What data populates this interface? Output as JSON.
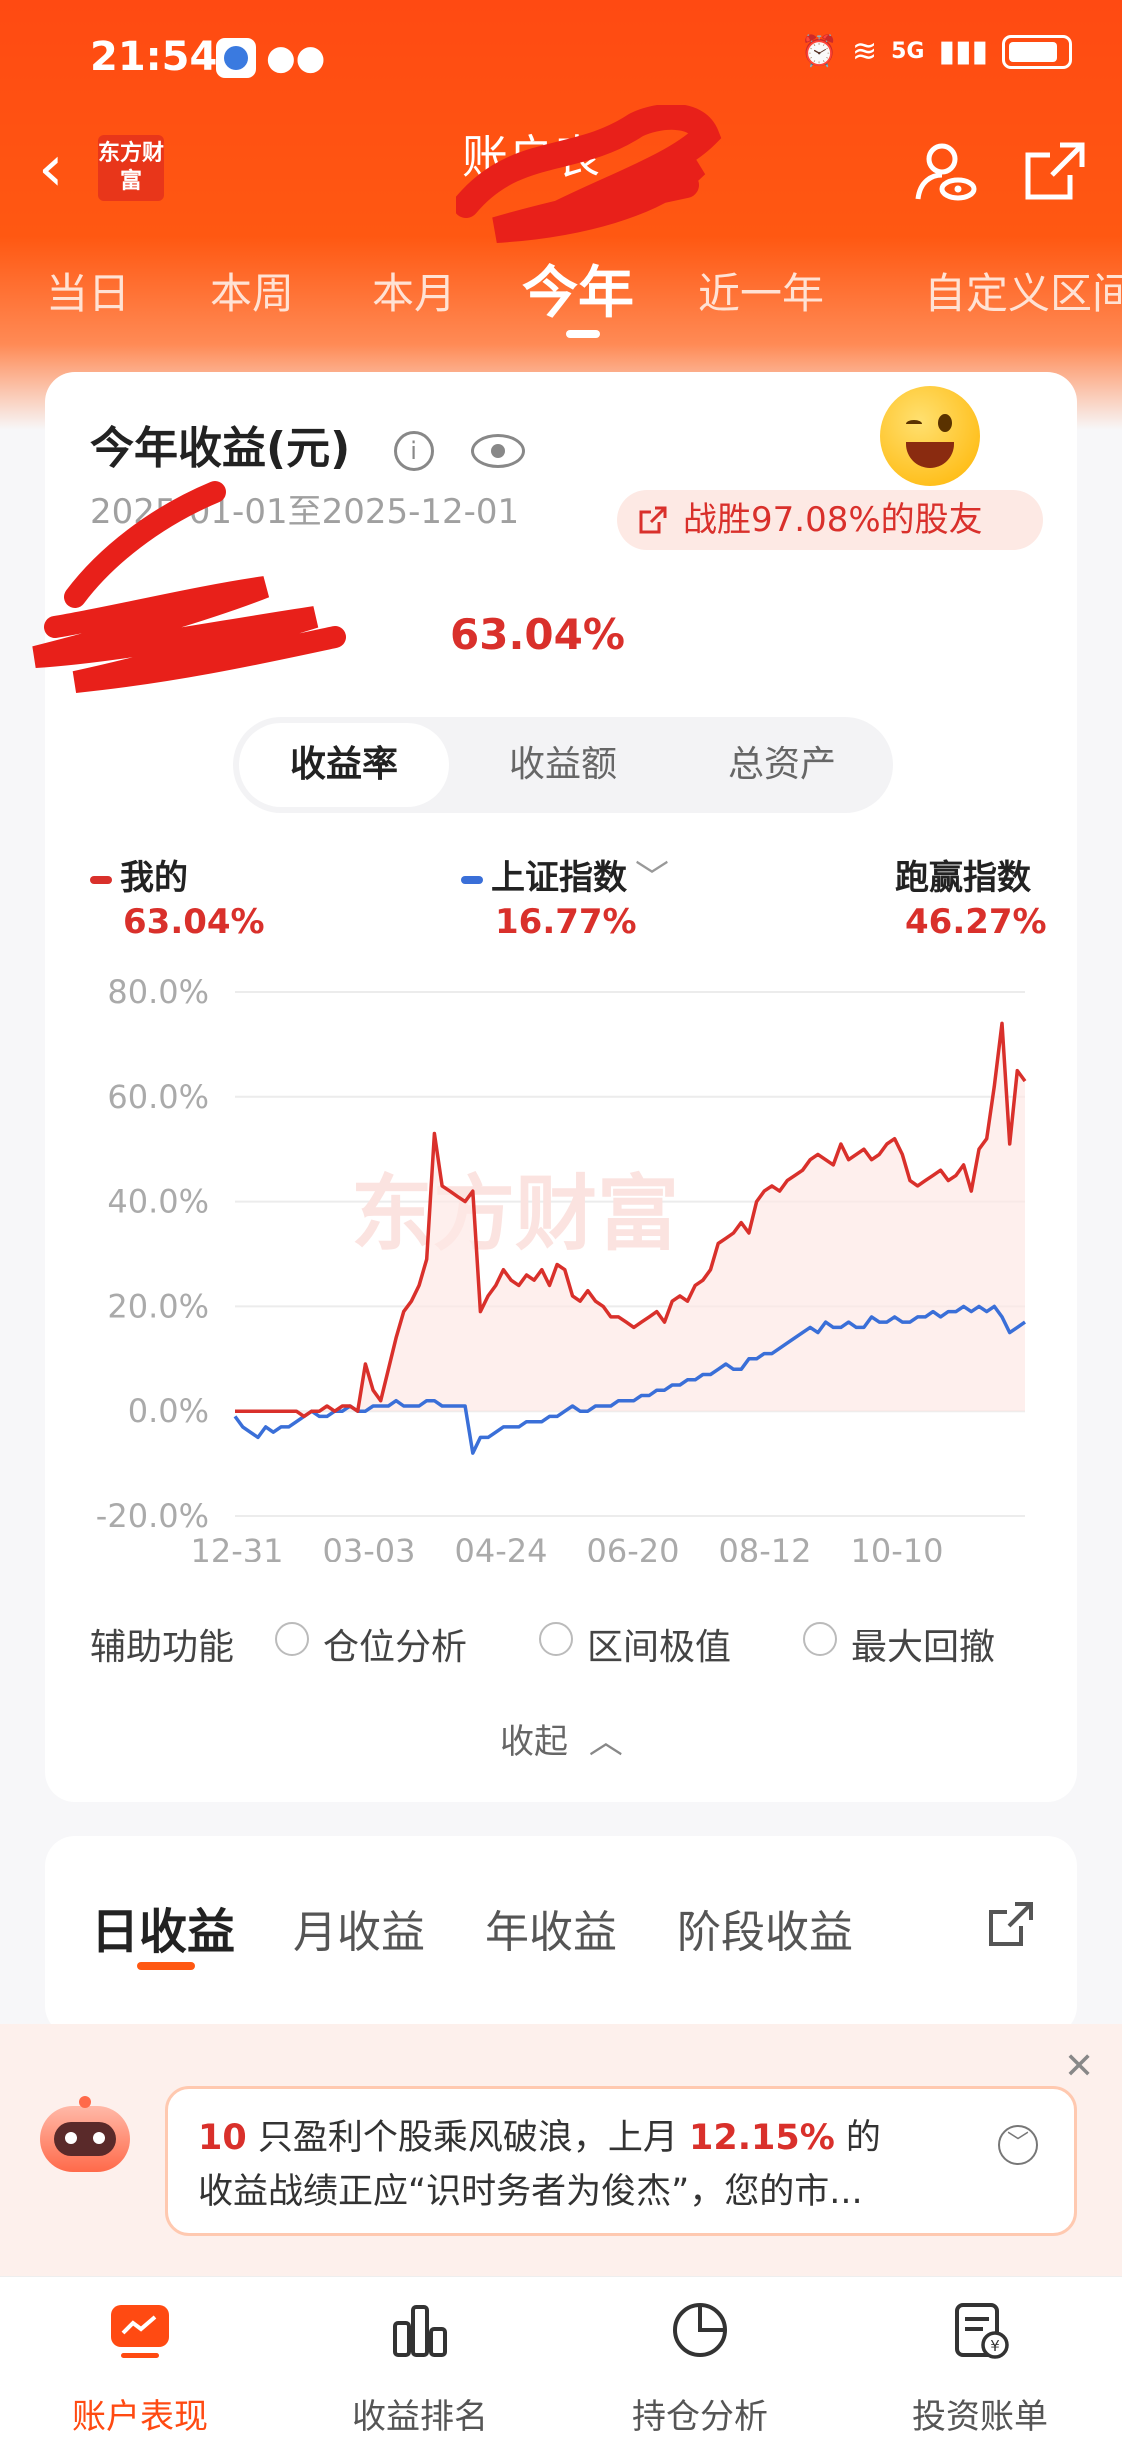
{
  "status": {
    "time": "21:54",
    "net": "5G"
  },
  "nav": {
    "title_visible": "账户表",
    "brand": "东方财富"
  },
  "periods": [
    "当日",
    "本周",
    "本月",
    "今年",
    "近一年",
    "自定义区间"
  ],
  "active_period": "今年",
  "card": {
    "title": "今年收益(元)",
    "date_range": "2025-01-01至2025-12-01",
    "win_badge": "战胜97.08%的股友",
    "return_pct": "63.04%",
    "segments": [
      "收益率",
      "收益额",
      "总资产"
    ],
    "active_segment": "收益率",
    "legend": [
      {
        "name": "我的",
        "value": "63.04%",
        "color": "#d9302b"
      },
      {
        "name": "上证指数",
        "value": "16.77%",
        "color": "#3a6fd8"
      },
      {
        "name": "跑赢指数",
        "value": "46.27%"
      }
    ],
    "aux_label": "辅助功能",
    "aux_options": [
      "仓位分析",
      "区间极值",
      "最大回撤"
    ],
    "collapse": "收起"
  },
  "chart_data": {
    "type": "line",
    "y_ticks": [
      "80.0%",
      "60.0%",
      "40.0%",
      "20.0%",
      "0.0%",
      "-20.0%"
    ],
    "x_ticks": [
      "12-31",
      "03-03",
      "04-24",
      "06-20",
      "08-12",
      "10-10"
    ],
    "ylim": [
      -20,
      80
    ],
    "watermark": "东方财富",
    "series": [
      {
        "name": "我的",
        "color": "#d9302b",
        "values": [
          0,
          0,
          0,
          0,
          0,
          0,
          0,
          0,
          0,
          -1,
          0,
          0,
          1,
          0,
          1,
          1,
          0,
          9,
          4,
          2,
          8,
          14,
          19,
          21,
          24,
          29,
          53,
          43,
          42,
          41,
          40,
          42,
          19,
          22,
          24,
          27,
          25,
          24,
          26,
          25,
          27,
          24,
          28,
          27,
          22,
          21,
          23,
          21,
          20,
          18,
          18,
          17,
          16,
          17,
          18,
          19,
          17,
          21,
          22,
          21,
          24,
          25,
          27,
          32,
          33,
          34,
          36,
          34,
          40,
          42,
          43,
          42,
          44,
          45,
          46,
          48,
          49,
          48,
          47,
          51,
          48,
          49,
          50,
          48,
          49,
          51,
          52,
          49,
          44,
          43,
          44,
          45,
          46,
          44,
          45,
          47,
          42,
          50,
          52,
          62,
          74,
          51,
          65,
          63
        ]
      },
      {
        "name": "上证指数",
        "color": "#3a6fd8",
        "values": [
          -1,
          -3,
          -4,
          -5,
          -3,
          -4,
          -3,
          -3,
          -2,
          -1,
          0,
          -1,
          -1,
          0,
          0,
          1,
          0,
          0,
          1,
          1,
          1,
          2,
          1,
          1,
          1,
          2,
          2,
          1,
          1,
          1,
          1,
          -8,
          -5,
          -5,
          -4,
          -3,
          -3,
          -3,
          -2,
          -2,
          -2,
          -1,
          -1,
          0,
          1,
          0,
          0,
          1,
          1,
          1,
          2,
          2,
          2,
          3,
          3,
          4,
          4,
          5,
          5,
          6,
          6,
          7,
          7,
          8,
          9,
          8,
          8,
          10,
          10,
          11,
          11,
          12,
          13,
          14,
          15,
          16,
          15,
          17,
          16,
          16,
          17,
          16,
          16,
          18,
          17,
          17,
          18,
          17,
          17,
          18,
          18,
          19,
          18,
          19,
          19,
          20,
          19,
          20,
          19,
          20,
          18,
          15,
          16,
          17
        ]
      }
    ]
  },
  "profit_tabs": [
    "日收益",
    "月收益",
    "年收益",
    "阶段收益"
  ],
  "active_profit_tab": "日收益",
  "notice": {
    "count": "10",
    "text1": " 只盈利个股乘风破浪，上月 ",
    "pct": "12.15%",
    "text2": " 的",
    "line2": "收益战绩正应“识时务者为俊杰”，您的市..."
  },
  "bottom_nav": [
    "账户表现",
    "收益排名",
    "持仓分析",
    "投资账单"
  ],
  "active_bottom": "账户表现"
}
